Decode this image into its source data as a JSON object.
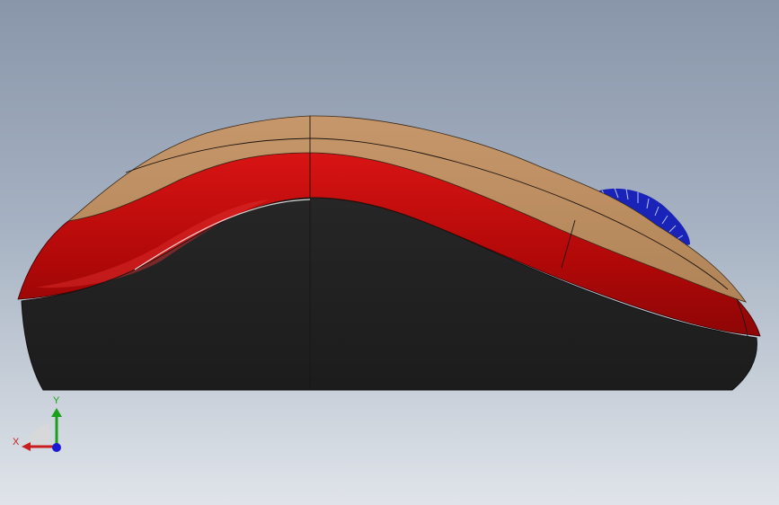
{
  "viewport": {
    "background_top": "#8996aa",
    "background_bottom": "#e0e4ea"
  },
  "model": {
    "top_shell_color": "#b88a5c",
    "side_band_color": "#c40c0c",
    "base_color": "#222222",
    "scroll_wheel_color": "#1a23b8",
    "edge_color": "#111111"
  },
  "triad": {
    "x_label": "X",
    "y_label": "Y",
    "x_color": "#c81e1e",
    "y_color": "#1aa01a",
    "z_color": "#1a1ad2"
  }
}
